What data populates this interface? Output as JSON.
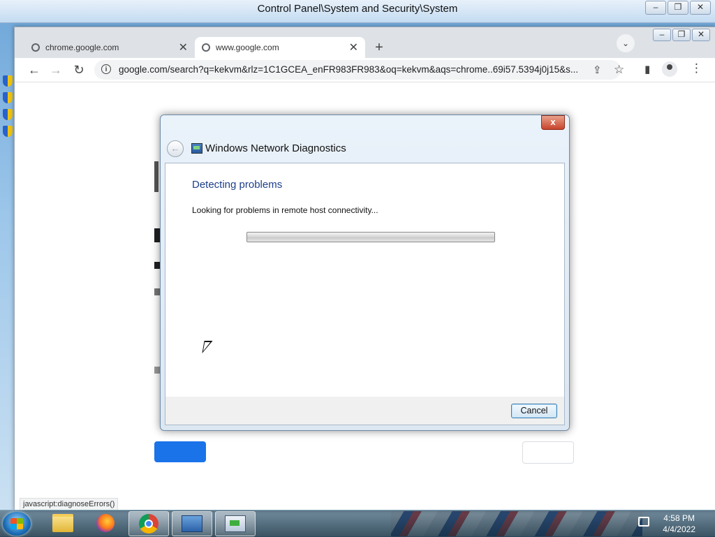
{
  "control_panel": {
    "title": "Control Panel\\System and Security\\System",
    "minimize": "‒",
    "maximize": "❐",
    "close": "✕"
  },
  "chrome": {
    "tabs": [
      {
        "label": "chrome.google.com",
        "close": "✕"
      },
      {
        "label": "www.google.com",
        "close": "✕"
      }
    ],
    "new_tab": "+",
    "tab_search": "⌄",
    "minimize": "‒",
    "maximize": "❐",
    "close": "✕",
    "back": "←",
    "forward": "→",
    "reload": "↻",
    "site_info": "i",
    "url": "google.com/search?q=kekvm&rlz=1C1GCEA_enFR983FR983&oq=kekvm&aqs=chrome..69i57.5394j0j15&s...",
    "share": "⇪",
    "bookmark": "☆",
    "side_panel": "▮",
    "menu": "⋮",
    "status_text": "javascript:diagnoseErrors()"
  },
  "dialog": {
    "close": "x",
    "back": "←",
    "title": "Windows Network Diagnostics",
    "heading": "Detecting problems",
    "message": "Looking for problems in remote host connectivity...",
    "progress_fraction": 0.0,
    "cancel_label": "Cancel"
  },
  "taskbar": {
    "time": "4:58 PM",
    "date": "4/4/2022",
    "items": [
      "windows-explorer",
      "firefox",
      "chrome",
      "control-panel",
      "network-diagnostics"
    ]
  }
}
